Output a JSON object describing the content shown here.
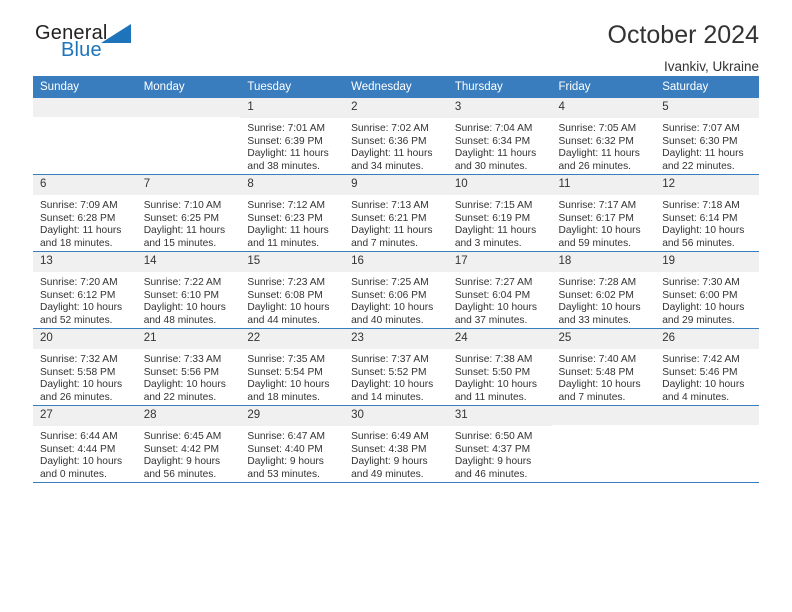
{
  "brand": {
    "name_part1": "General",
    "name_part2": "Blue"
  },
  "header": {
    "title": "October 2024",
    "location": "Ivankiv, Ukraine"
  },
  "colors": {
    "header_blue": "#3a7dbf",
    "logo_blue": "#1e74bb",
    "daynum_background": "#f0f0f0",
    "text": "#333333"
  },
  "weekday_headers": [
    "Sunday",
    "Monday",
    "Tuesday",
    "Wednesday",
    "Thursday",
    "Friday",
    "Saturday"
  ],
  "weeks": [
    [
      {
        "day": "",
        "blank": true,
        "sunrise": "",
        "sunset": "",
        "daylight_line1": "",
        "daylight_line2": ""
      },
      {
        "day": "",
        "blank": true,
        "sunrise": "",
        "sunset": "",
        "daylight_line1": "",
        "daylight_line2": ""
      },
      {
        "day": "1",
        "blank": false,
        "sunrise": "Sunrise: 7:01 AM",
        "sunset": "Sunset: 6:39 PM",
        "daylight_line1": "Daylight: 11 hours",
        "daylight_line2": "and 38 minutes."
      },
      {
        "day": "2",
        "blank": false,
        "sunrise": "Sunrise: 7:02 AM",
        "sunset": "Sunset: 6:36 PM",
        "daylight_line1": "Daylight: 11 hours",
        "daylight_line2": "and 34 minutes."
      },
      {
        "day": "3",
        "blank": false,
        "sunrise": "Sunrise: 7:04 AM",
        "sunset": "Sunset: 6:34 PM",
        "daylight_line1": "Daylight: 11 hours",
        "daylight_line2": "and 30 minutes."
      },
      {
        "day": "4",
        "blank": false,
        "sunrise": "Sunrise: 7:05 AM",
        "sunset": "Sunset: 6:32 PM",
        "daylight_line1": "Daylight: 11 hours",
        "daylight_line2": "and 26 minutes."
      },
      {
        "day": "5",
        "blank": false,
        "sunrise": "Sunrise: 7:07 AM",
        "sunset": "Sunset: 6:30 PM",
        "daylight_line1": "Daylight: 11 hours",
        "daylight_line2": "and 22 minutes."
      }
    ],
    [
      {
        "day": "6",
        "blank": false,
        "sunrise": "Sunrise: 7:09 AM",
        "sunset": "Sunset: 6:28 PM",
        "daylight_line1": "Daylight: 11 hours",
        "daylight_line2": "and 18 minutes."
      },
      {
        "day": "7",
        "blank": false,
        "sunrise": "Sunrise: 7:10 AM",
        "sunset": "Sunset: 6:25 PM",
        "daylight_line1": "Daylight: 11 hours",
        "daylight_line2": "and 15 minutes."
      },
      {
        "day": "8",
        "blank": false,
        "sunrise": "Sunrise: 7:12 AM",
        "sunset": "Sunset: 6:23 PM",
        "daylight_line1": "Daylight: 11 hours",
        "daylight_line2": "and 11 minutes."
      },
      {
        "day": "9",
        "blank": false,
        "sunrise": "Sunrise: 7:13 AM",
        "sunset": "Sunset: 6:21 PM",
        "daylight_line1": "Daylight: 11 hours",
        "daylight_line2": "and 7 minutes."
      },
      {
        "day": "10",
        "blank": false,
        "sunrise": "Sunrise: 7:15 AM",
        "sunset": "Sunset: 6:19 PM",
        "daylight_line1": "Daylight: 11 hours",
        "daylight_line2": "and 3 minutes."
      },
      {
        "day": "11",
        "blank": false,
        "sunrise": "Sunrise: 7:17 AM",
        "sunset": "Sunset: 6:17 PM",
        "daylight_line1": "Daylight: 10 hours",
        "daylight_line2": "and 59 minutes."
      },
      {
        "day": "12",
        "blank": false,
        "sunrise": "Sunrise: 7:18 AM",
        "sunset": "Sunset: 6:14 PM",
        "daylight_line1": "Daylight: 10 hours",
        "daylight_line2": "and 56 minutes."
      }
    ],
    [
      {
        "day": "13",
        "blank": false,
        "sunrise": "Sunrise: 7:20 AM",
        "sunset": "Sunset: 6:12 PM",
        "daylight_line1": "Daylight: 10 hours",
        "daylight_line2": "and 52 minutes."
      },
      {
        "day": "14",
        "blank": false,
        "sunrise": "Sunrise: 7:22 AM",
        "sunset": "Sunset: 6:10 PM",
        "daylight_line1": "Daylight: 10 hours",
        "daylight_line2": "and 48 minutes."
      },
      {
        "day": "15",
        "blank": false,
        "sunrise": "Sunrise: 7:23 AM",
        "sunset": "Sunset: 6:08 PM",
        "daylight_line1": "Daylight: 10 hours",
        "daylight_line2": "and 44 minutes."
      },
      {
        "day": "16",
        "blank": false,
        "sunrise": "Sunrise: 7:25 AM",
        "sunset": "Sunset: 6:06 PM",
        "daylight_line1": "Daylight: 10 hours",
        "daylight_line2": "and 40 minutes."
      },
      {
        "day": "17",
        "blank": false,
        "sunrise": "Sunrise: 7:27 AM",
        "sunset": "Sunset: 6:04 PM",
        "daylight_line1": "Daylight: 10 hours",
        "daylight_line2": "and 37 minutes."
      },
      {
        "day": "18",
        "blank": false,
        "sunrise": "Sunrise: 7:28 AM",
        "sunset": "Sunset: 6:02 PM",
        "daylight_line1": "Daylight: 10 hours",
        "daylight_line2": "and 33 minutes."
      },
      {
        "day": "19",
        "blank": false,
        "sunrise": "Sunrise: 7:30 AM",
        "sunset": "Sunset: 6:00 PM",
        "daylight_line1": "Daylight: 10 hours",
        "daylight_line2": "and 29 minutes."
      }
    ],
    [
      {
        "day": "20",
        "blank": false,
        "sunrise": "Sunrise: 7:32 AM",
        "sunset": "Sunset: 5:58 PM",
        "daylight_line1": "Daylight: 10 hours",
        "daylight_line2": "and 26 minutes."
      },
      {
        "day": "21",
        "blank": false,
        "sunrise": "Sunrise: 7:33 AM",
        "sunset": "Sunset: 5:56 PM",
        "daylight_line1": "Daylight: 10 hours",
        "daylight_line2": "and 22 minutes."
      },
      {
        "day": "22",
        "blank": false,
        "sunrise": "Sunrise: 7:35 AM",
        "sunset": "Sunset: 5:54 PM",
        "daylight_line1": "Daylight: 10 hours",
        "daylight_line2": "and 18 minutes."
      },
      {
        "day": "23",
        "blank": false,
        "sunrise": "Sunrise: 7:37 AM",
        "sunset": "Sunset: 5:52 PM",
        "daylight_line1": "Daylight: 10 hours",
        "daylight_line2": "and 14 minutes."
      },
      {
        "day": "24",
        "blank": false,
        "sunrise": "Sunrise: 7:38 AM",
        "sunset": "Sunset: 5:50 PM",
        "daylight_line1": "Daylight: 10 hours",
        "daylight_line2": "and 11 minutes."
      },
      {
        "day": "25",
        "blank": false,
        "sunrise": "Sunrise: 7:40 AM",
        "sunset": "Sunset: 5:48 PM",
        "daylight_line1": "Daylight: 10 hours",
        "daylight_line2": "and 7 minutes."
      },
      {
        "day": "26",
        "blank": false,
        "sunrise": "Sunrise: 7:42 AM",
        "sunset": "Sunset: 5:46 PM",
        "daylight_line1": "Daylight: 10 hours",
        "daylight_line2": "and 4 minutes."
      }
    ],
    [
      {
        "day": "27",
        "blank": false,
        "sunrise": "Sunrise: 6:44 AM",
        "sunset": "Sunset: 4:44 PM",
        "daylight_line1": "Daylight: 10 hours",
        "daylight_line2": "and 0 minutes."
      },
      {
        "day": "28",
        "blank": false,
        "sunrise": "Sunrise: 6:45 AM",
        "sunset": "Sunset: 4:42 PM",
        "daylight_line1": "Daylight: 9 hours",
        "daylight_line2": "and 56 minutes."
      },
      {
        "day": "29",
        "blank": false,
        "sunrise": "Sunrise: 6:47 AM",
        "sunset": "Sunset: 4:40 PM",
        "daylight_line1": "Daylight: 9 hours",
        "daylight_line2": "and 53 minutes."
      },
      {
        "day": "30",
        "blank": false,
        "sunrise": "Sunrise: 6:49 AM",
        "sunset": "Sunset: 4:38 PM",
        "daylight_line1": "Daylight: 9 hours",
        "daylight_line2": "and 49 minutes."
      },
      {
        "day": "31",
        "blank": false,
        "sunrise": "Sunrise: 6:50 AM",
        "sunset": "Sunset: 4:37 PM",
        "daylight_line1": "Daylight: 9 hours",
        "daylight_line2": "and 46 minutes."
      },
      {
        "day": "",
        "blank": true,
        "sunrise": "",
        "sunset": "",
        "daylight_line1": "",
        "daylight_line2": ""
      },
      {
        "day": "",
        "blank": true,
        "sunrise": "",
        "sunset": "",
        "daylight_line1": "",
        "daylight_line2": ""
      }
    ]
  ]
}
